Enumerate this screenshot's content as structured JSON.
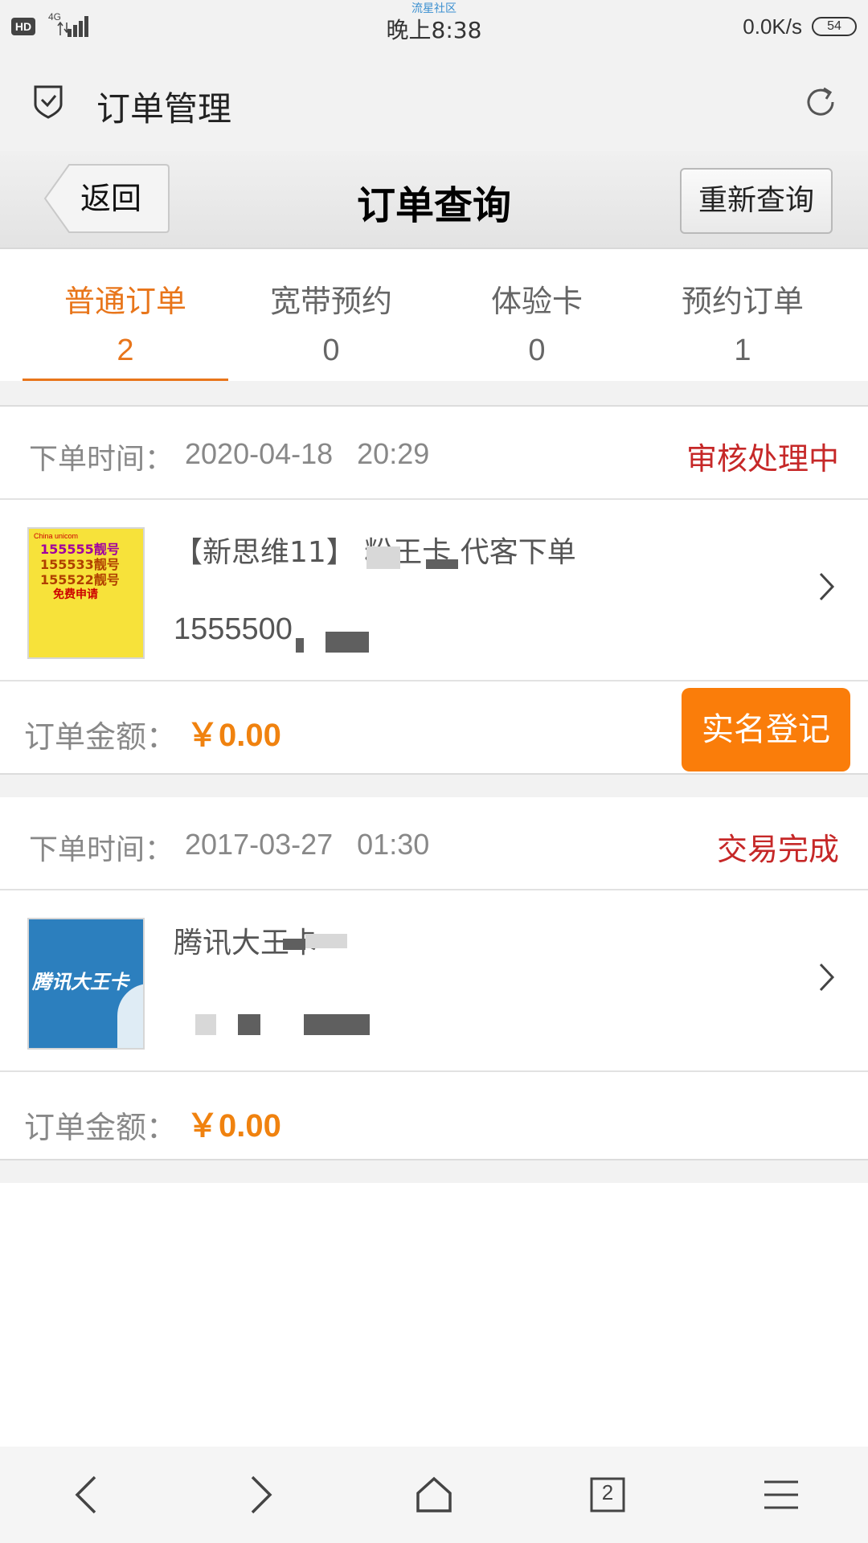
{
  "status_bar": {
    "hd": "HD",
    "network": "4G",
    "watermark": "流星社区",
    "time": "晚上8:38",
    "speed": "0.0K/s",
    "battery": "54"
  },
  "app_bar": {
    "title": "订单管理"
  },
  "header": {
    "back_label": "返回",
    "title": "订单查询",
    "requery_label": "重新查询"
  },
  "tabs": [
    {
      "label": "普通订单",
      "count": "2",
      "active": true
    },
    {
      "label": "宽带预约",
      "count": "0",
      "active": false
    },
    {
      "label": "体验卡",
      "count": "0",
      "active": false
    },
    {
      "label": "预约订单",
      "count": "1",
      "active": false
    }
  ],
  "orders": [
    {
      "time_label": "下单时间：",
      "time": "2020-04-18   20:29",
      "status": "审核处理中",
      "product_name": "【新思维11】 粉王卡 代客下单",
      "product_number": "1555500",
      "thumb_lines": [
        "155555靓号",
        "155533靓号",
        "155522靓号",
        "免费申请"
      ],
      "amount_label": "订单金额：",
      "amount": "￥0.00",
      "action_label": "实名登记"
    },
    {
      "time_label": "下单时间：",
      "time": "2017-03-27   01:30",
      "status": "交易完成",
      "product_name": "腾讯大王卡",
      "product_number": "",
      "thumb_text": "腾讯大王卡",
      "amount_label": "订单金额：",
      "amount": "￥0.00"
    }
  ],
  "colors": {
    "accent": "#e8751a",
    "status_red": "#c62828",
    "amount_orange": "#f0820f",
    "button_orange": "#fa7d0a"
  },
  "bottom_nav": {
    "icons": [
      "back-icon",
      "forward-icon",
      "home-icon",
      "tabs-icon",
      "menu-icon"
    ],
    "tab_count": "2"
  }
}
